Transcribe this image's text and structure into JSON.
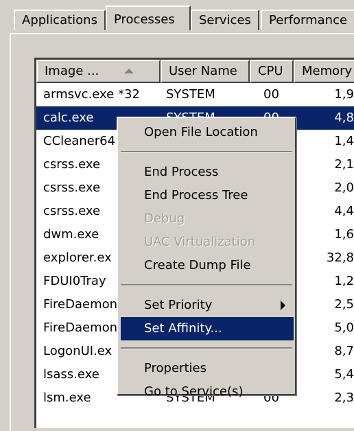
{
  "tabs": [
    {
      "label": "Applications",
      "active": false
    },
    {
      "label": "Processes",
      "active": true
    },
    {
      "label": "Services",
      "active": false
    },
    {
      "label": "Performance",
      "active": false
    }
  ],
  "columns": [
    "Image ...",
    "User Name",
    "CPU",
    "Memory"
  ],
  "sort_column": "Image Name",
  "sort_direction": "ascending",
  "rows": [
    {
      "image": "armsvc.exe *32",
      "user": "SYSTEM",
      "cpu": "00",
      "memory": "1,9"
    },
    {
      "image": "calc.exe",
      "user": "SYSTEM",
      "cpu": "00",
      "memory": "4,8",
      "selected": true
    },
    {
      "image": "CCleaner64",
      "user": "",
      "cpu": "",
      "memory": "1,4"
    },
    {
      "image": "csrss.exe",
      "user": "",
      "cpu": "",
      "memory": "2,1"
    },
    {
      "image": "csrss.exe",
      "user": "",
      "cpu": "",
      "memory": "2,0"
    },
    {
      "image": "csrss.exe",
      "user": "",
      "cpu": "",
      "memory": "4,4"
    },
    {
      "image": "dwm.exe",
      "user": "",
      "cpu": "",
      "memory": "1,6"
    },
    {
      "image": "explorer.ex",
      "user": "",
      "cpu": "",
      "memory": "32,8"
    },
    {
      "image": "FDUI0Tray",
      "user": "",
      "cpu": "",
      "memory": "1,2"
    },
    {
      "image": "FireDaemon",
      "user": "",
      "cpu": "",
      "memory": "2,5"
    },
    {
      "image": "FireDaemon",
      "user": "",
      "cpu": "",
      "memory": "5,0"
    },
    {
      "image": "LogonUI.ex",
      "user": "",
      "cpu": "",
      "memory": "8,7"
    },
    {
      "image": "lsass.exe",
      "user": "",
      "cpu": "",
      "memory": "5,4"
    },
    {
      "image": "lsm.exe",
      "user": "SYSTEM",
      "cpu": "00",
      "memory": "2,3"
    }
  ],
  "context_menu": {
    "items": [
      {
        "label": "Open File Location"
      },
      {
        "separator": true
      },
      {
        "label": "End Process"
      },
      {
        "label": "End Process Tree"
      },
      {
        "label": "Debug",
        "disabled": true
      },
      {
        "label": "UAC Virtualization",
        "disabled": true
      },
      {
        "label": "Create Dump File"
      },
      {
        "separator": true
      },
      {
        "label": "Set Priority",
        "submenu": true
      },
      {
        "label": "Set Affinity...",
        "highlighted": true
      },
      {
        "separator": true
      },
      {
        "label": "Properties"
      },
      {
        "label": "Go to Service(s)"
      }
    ]
  },
  "colors": {
    "selection": "#0a246a",
    "face": "#d4d0c8",
    "disabled_text": "#a0a0a0"
  }
}
